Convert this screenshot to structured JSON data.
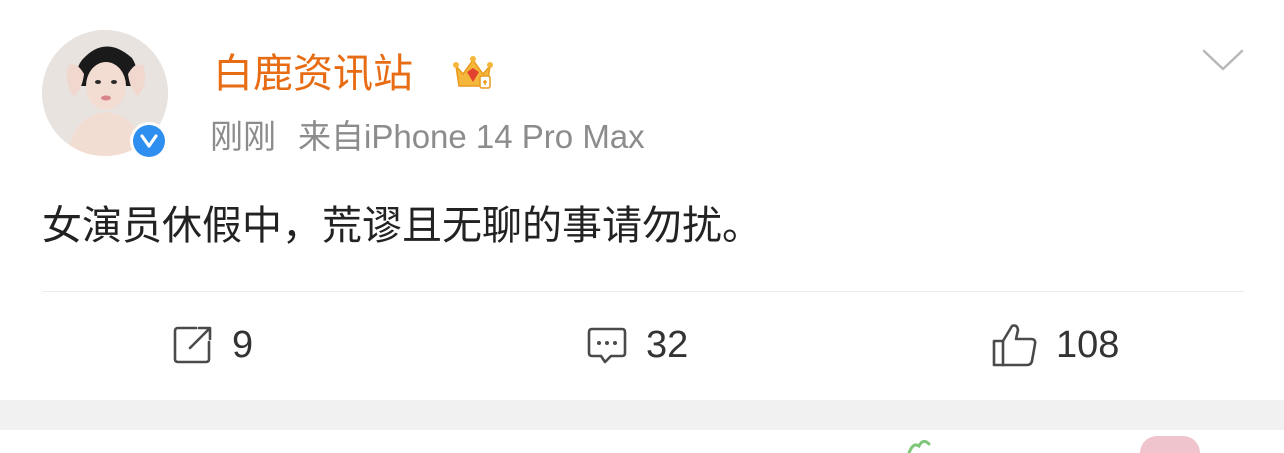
{
  "post": {
    "username": "白鹿资讯站",
    "time": "刚刚",
    "source": "来自iPhone 14 Pro Max",
    "content": "女演员休假中，荒谬且无聊的事请勿扰。"
  },
  "actions": {
    "repost_count": "9",
    "comment_count": "32",
    "like_count": "108"
  },
  "colors": {
    "username": "#e86c13",
    "verified": "#2f8ff0",
    "meta": "#8c8c8c",
    "text": "#222222"
  },
  "icons": [
    "chevron-down-icon",
    "crown-badge-icon",
    "verified-icon",
    "repost-icon",
    "comment-icon",
    "like-icon"
  ]
}
